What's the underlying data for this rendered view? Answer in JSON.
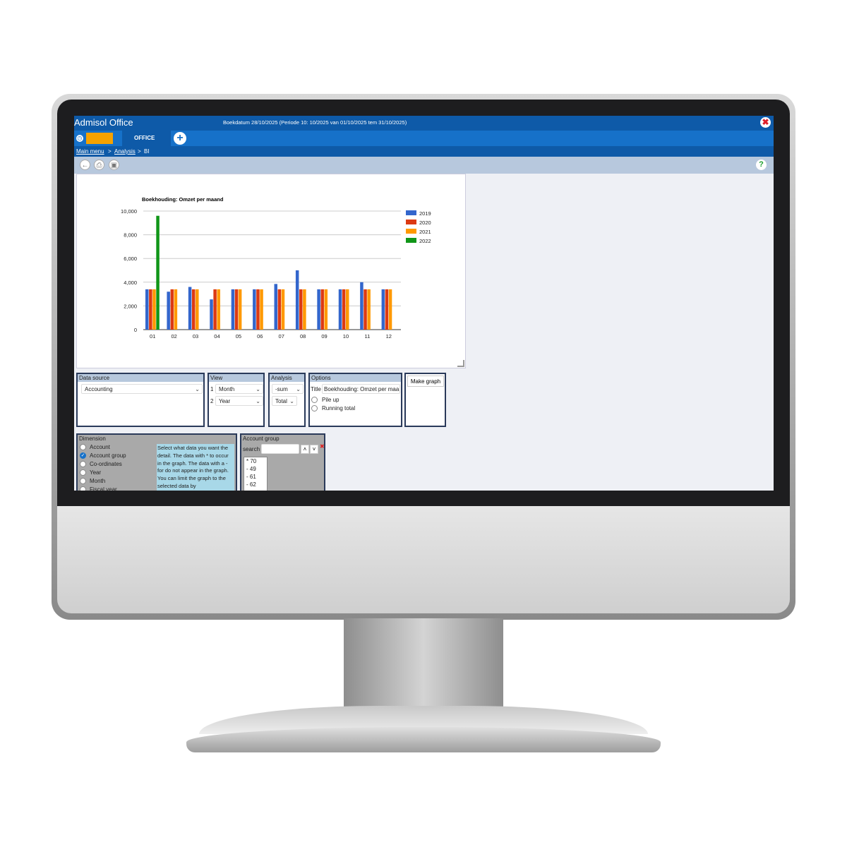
{
  "app": {
    "title": "Admisol Office",
    "booking_info": "Boekdatum 28/10/2025 (Periode 10: 10/2025 van 01/10/2025 tem 31/10/2025)"
  },
  "tabs": {
    "active_label": "OFFICE"
  },
  "breadcrumb": {
    "main_menu": "Main menu",
    "sep": ">",
    "analysis": "Analysis",
    "current": "BI"
  },
  "chart_data": {
    "type": "bar",
    "title": "Boekhouding: Omzet per maand",
    "categories": [
      "01",
      "02",
      "03",
      "04",
      "05",
      "06",
      "07",
      "08",
      "09",
      "10",
      "11",
      "12"
    ],
    "ylim": [
      0,
      10000
    ],
    "yticks": [
      "0",
      "2,000",
      "4,000",
      "6,000",
      "8,000",
      "10,000"
    ],
    "grid": true,
    "legend_position": "right",
    "series": [
      {
        "name": "2019",
        "color": "#3366cc",
        "values": [
          3400,
          3200,
          3600,
          2550,
          3400,
          3400,
          3850,
          5000,
          3400,
          3400,
          4000,
          3400
        ]
      },
      {
        "name": "2020",
        "color": "#dc3912",
        "values": [
          3400,
          3400,
          3400,
          3400,
          3400,
          3400,
          3400,
          3400,
          3400,
          3400,
          3400,
          3400
        ]
      },
      {
        "name": "2021",
        "color": "#ff9900",
        "values": [
          3400,
          3400,
          3400,
          3400,
          3400,
          3400,
          3400,
          3400,
          3400,
          3400,
          3400,
          3400
        ]
      },
      {
        "name": "2022",
        "color": "#109618",
        "values": [
          9600,
          0,
          0,
          0,
          0,
          0,
          0,
          0,
          0,
          0,
          0,
          0
        ]
      }
    ]
  },
  "data_source": {
    "header": "Data source",
    "value": "Accounting"
  },
  "view": {
    "header": "View",
    "row1_num": "1",
    "row1_value": "Month",
    "row2_num": "2",
    "row2_value": "Year"
  },
  "analysis": {
    "header": "Analysis",
    "func": "-sum",
    "total": "Total"
  },
  "options": {
    "header": "Options",
    "title_label": "Title",
    "title_value": "Boekhouding: Omzet per maa",
    "pile_up": "Pile up",
    "running_total": "Running total"
  },
  "make_graph": {
    "label": "Make graph"
  },
  "dimension": {
    "header": "Dimension",
    "items": [
      {
        "label": "Account",
        "checked": false
      },
      {
        "label": "Account group",
        "checked": true
      },
      {
        "label": "Co-ordinates",
        "checked": false
      },
      {
        "label": "Year",
        "checked": false
      },
      {
        "label": "Month",
        "checked": false
      },
      {
        "label": "Fiscal year",
        "checked": false
      }
    ],
    "help": "Select what data you want the detail. The data with * to occur in the graph. The data with a - for do not appear in the graph. You can limit the graph to the selected data by"
  },
  "account_group": {
    "header": "Account group",
    "search_label": "search",
    "items": [
      "* 70",
      "- 49",
      "- 61",
      "- 62"
    ]
  }
}
